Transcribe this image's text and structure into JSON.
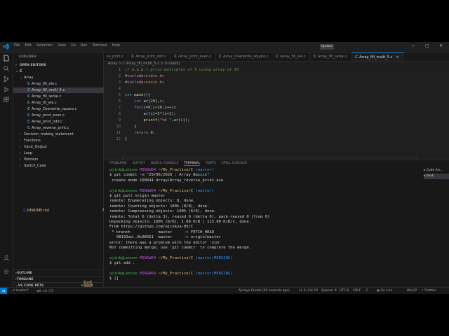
{
  "menu": [
    "File",
    "Edit",
    "Selection",
    "View",
    "Go",
    "Run",
    "Terminal",
    "Help"
  ],
  "update_label": "Update",
  "sidebar": {
    "title": "EXPLORER",
    "open_editors": "OPEN EDITORS",
    "root": "C",
    "array_folder": "Array",
    "files": [
      {
        "name": "Array_fill_ele.c",
        "sel": false
      },
      {
        "name": "Array_fill_multi_5.c",
        "sel": true
      },
      {
        "name": "Array_fill_serial.c",
        "sel": false
      },
      {
        "name": "Array_IO_ele.c",
        "sel": false
      },
      {
        "name": "Array_Overwrite_square.c",
        "sel": false
      },
      {
        "name": "Array_print_even.c",
        "sel": false
      },
      {
        "name": "Array_print_odd.c",
        "sel": false
      },
      {
        "name": "Array_reverse_print.c",
        "sel": false
      }
    ],
    "folders": [
      "Decision_making_statement",
      "Functions",
      "Input_Output",
      "Loop",
      "Pointers",
      "Switch_Case"
    ],
    "readme": "README.md",
    "readme_badge": "3, M",
    "outline": "OUTLINE",
    "timeline": "TIMELINE",
    "vscode_pets": "VS CODE PETS",
    "pets_count": "0"
  },
  "tabs": [
    {
      "name": "se_print.c",
      "active": false
    },
    {
      "name": "Array_print_odd.c",
      "active": false
    },
    {
      "name": "Array_print_even.c",
      "active": false
    },
    {
      "name": "Array_Overwrite_square.c",
      "active": false
    },
    {
      "name": "Array_fill_ele.c",
      "active": false
    },
    {
      "name": "Array_fill_serial.c",
      "active": false
    },
    {
      "name": "Array_fill_multi_5.c",
      "active": true
    }
  ],
  "breadcrumb": "Array > C Array_fill_multi_5.c > ⊘ main()",
  "code_lines": [
    "// w.a.p.t.print multiples of 5 using array of 20",
    "#include<stdio.h>",
    "#include<conio.h>",
    "",
    "int main(){",
    "    int ar[20],i;",
    "    for(i=0;i<20;i++){",
    "        ar[i]=5*(i+1);",
    "        printf(\"%d \",ar[i]);",
    "    }",
    "    return 0;",
    "}"
  ],
  "panel_tabs": [
    "PROBLEMS",
    "OUTPUT",
    "DEBUG CONSOLE",
    "TERMINAL",
    "PORTS",
    "SPELL CHECKER"
  ],
  "active_panel_tab": "TERMINAL",
  "terminal": {
    "user": "ajink@Lenovo",
    "shell": "MINGW64",
    "path": "~/My_Practice/C",
    "lines": [
      "$ git commit -m \"29/06/2026 : Array Basics\"",
      " create mode 100644 Array/Array_reverse_print.exe",
      "",
      "$ git pull origin master",
      "remote: Enumerating objects: 8, done.",
      "remote: Counting objects: 100% (8/8), done.",
      "remote: Compressing objects: 100% (6/6), done.",
      "remote: Total 6 (delta 3), reused 0 (delta 0), pack-reused 0 (from 0)",
      "Unpacking objects: 100% (6/6), 1.88 KiB | 115.00 KiB/s, done.",
      "From https://github.com/ajinkya-85/C",
      " * branch            master     -> FETCH_HEAD",
      "   08193ad..8c08551  master     -> origin/master",
      "error: there was a problem with the editor 'vim'",
      "Not committing merge; use 'git commit' to complete the merge.",
      "",
      "$ git add .",
      "",
      "$ []"
    ],
    "branch1": "(master)",
    "branch2": "(master|MERGING)",
    "sessions": [
      "Code Arr...",
      "bash"
    ]
  },
  "status": {
    "branch": "master*",
    "errors": "0",
    "warnings": "0",
    "info": "3",
    "blame": "Ajinkya Ghode (40 seconds ago)",
    "position": "Ln 9, Col 29",
    "spaces": "Spaces: 4",
    "encoding": "UTF-8",
    "eol": "CRLF",
    "language": "C",
    "golive": "Go Live",
    "platform": "Win32",
    "prettier": "Prettier"
  }
}
